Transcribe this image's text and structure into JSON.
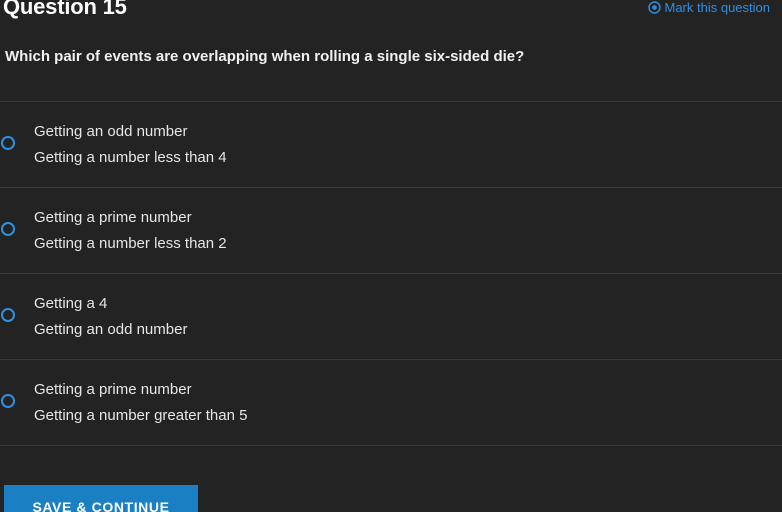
{
  "header": {
    "title": "Question 15",
    "mark_label": "Mark this question",
    "mark_icon": "target-icon"
  },
  "question": {
    "text": "Which pair of events are overlapping when rolling a single six-sided die?"
  },
  "options": [
    {
      "line1": "Getting an odd number",
      "line2": "Getting a number less than 4"
    },
    {
      "line1": "Getting a prime number",
      "line2": "Getting a number less than 2"
    },
    {
      "line1": "Getting a 4",
      "line2": "Getting an odd number"
    },
    {
      "line1": "Getting a prime number",
      "line2": "Getting a number greater than 5"
    }
  ],
  "actions": {
    "save_label": "SAVE & CONTINUE"
  },
  "colors": {
    "accent": "#2f8fe0",
    "button": "#1b7fc4",
    "background": "#232323"
  }
}
